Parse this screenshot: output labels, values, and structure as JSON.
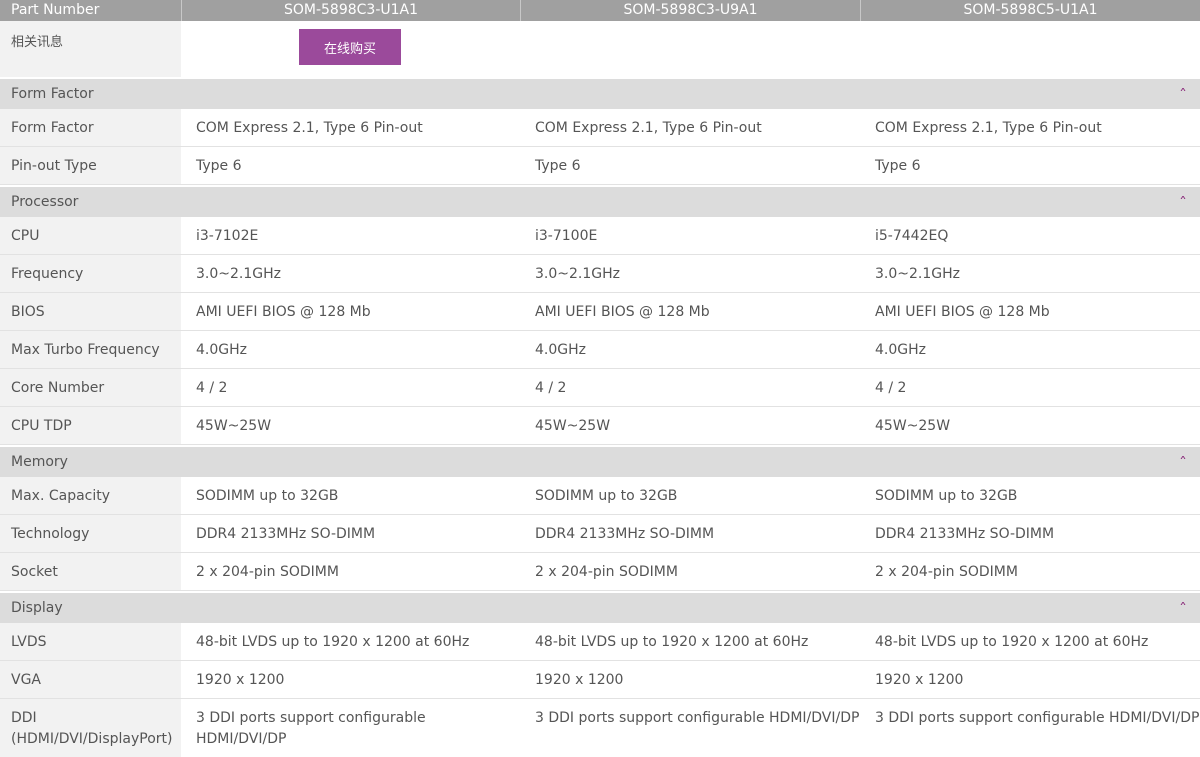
{
  "header": {
    "part_number_label": "Part Number",
    "models": [
      "SOM-5898C3-U1A1",
      "SOM-5898C3-U9A1",
      "SOM-5898C5-U1A1"
    ]
  },
  "info_row": {
    "label": "相关讯息",
    "buy_button": "在线购买"
  },
  "sections": [
    {
      "title": "Form Factor",
      "rows": [
        {
          "label": "Form Factor",
          "values": [
            "COM Express 2.1, Type 6 Pin-out",
            "COM Express 2.1, Type 6 Pin-out",
            "COM Express 2.1, Type 6 Pin-out"
          ]
        },
        {
          "label": "Pin-out Type",
          "values": [
            "Type 6",
            "Type 6",
            "Type 6"
          ]
        }
      ]
    },
    {
      "title": "Processor",
      "rows": [
        {
          "label": "CPU",
          "values": [
            "i3-7102E",
            "i3-7100E",
            "i5-7442EQ"
          ]
        },
        {
          "label": "Frequency",
          "values": [
            "3.0~2.1GHz",
            "3.0~2.1GHz",
            "3.0~2.1GHz"
          ]
        },
        {
          "label": "BIOS",
          "values": [
            "AMI UEFI BIOS @ 128 Mb",
            "AMI UEFI BIOS @ 128 Mb",
            "AMI UEFI BIOS @ 128 Mb"
          ]
        },
        {
          "label": "Max Turbo Frequency",
          "values": [
            "4.0GHz",
            "4.0GHz",
            "4.0GHz"
          ]
        },
        {
          "label": "Core Number",
          "values": [
            "4 / 2",
            "4 / 2",
            "4 / 2"
          ]
        },
        {
          "label": "CPU TDP",
          "values": [
            "45W~25W",
            "45W~25W",
            "45W~25W"
          ]
        }
      ]
    },
    {
      "title": "Memory",
      "rows": [
        {
          "label": "Max. Capacity",
          "values": [
            "SODIMM up to 32GB",
            "SODIMM up to 32GB",
            "SODIMM up to 32GB"
          ]
        },
        {
          "label": "Technology",
          "values": [
            "DDR4 2133MHz SO-DIMM",
            "DDR4 2133MHz SO-DIMM",
            "DDR4 2133MHz SO-DIMM"
          ]
        },
        {
          "label": "Socket",
          "values": [
            "2 x 204-pin SODIMM",
            "2 x 204-pin SODIMM",
            "2 x 204-pin SODIMM"
          ]
        }
      ]
    },
    {
      "title": "Display",
      "rows": [
        {
          "label": "LVDS",
          "values": [
            "48-bit LVDS up to 1920 x 1200 at 60Hz",
            "48-bit LVDS up to 1920 x 1200 at 60Hz",
            "48-bit LVDS up to 1920 x 1200 at 60Hz"
          ]
        },
        {
          "label": "VGA",
          "values": [
            "1920 x 1200",
            "1920 x 1200",
            "1920 x 1200"
          ]
        },
        {
          "label": "DDI (HDMI/DVI/DisplayPort)",
          "values": [
            "3 DDI ports support configurable HDMI/DVI/DP",
            "3 DDI ports support configurable HDMI/DVI/DP",
            "3 DDI ports support configurable HDMI/DVI/DP"
          ]
        }
      ]
    }
  ],
  "icons": {
    "collapse": "chevron-up-icon"
  },
  "colors": {
    "header_bg": "#a0a0a0",
    "section_bg": "#dcdcdc",
    "button_bg": "#9b4a9b",
    "chevron": "#8a2a7a"
  }
}
